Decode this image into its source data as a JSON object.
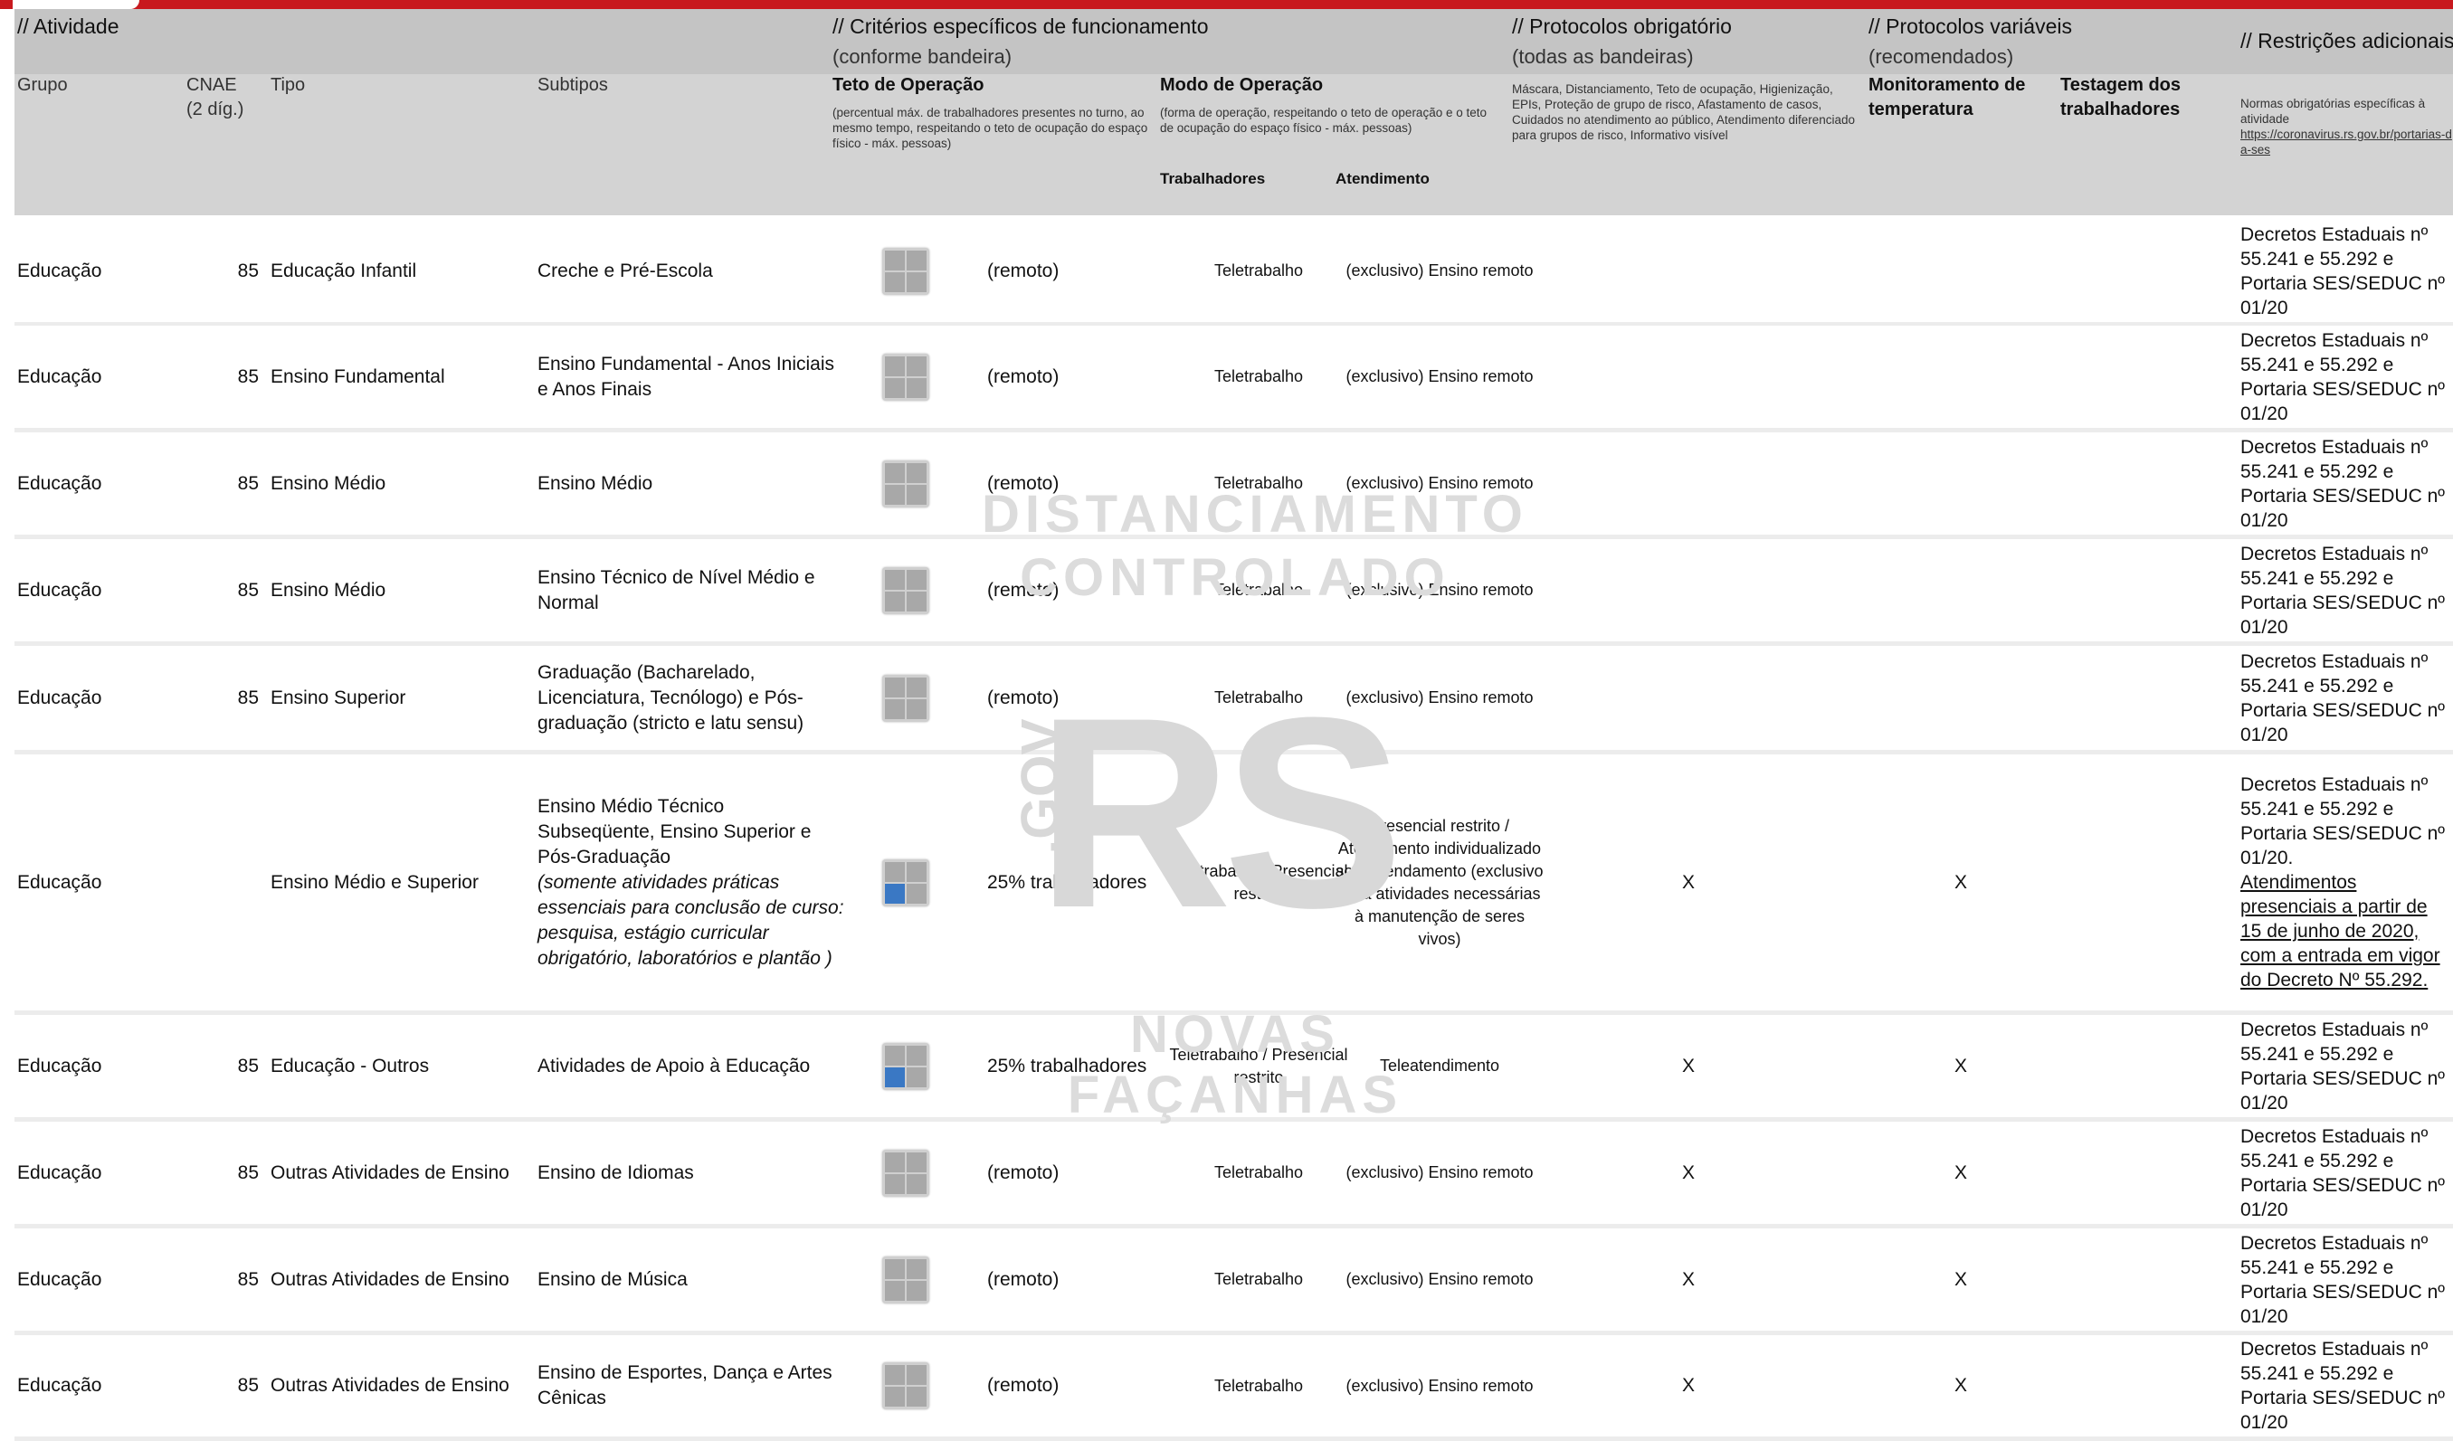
{
  "header": {
    "atividade": "// Atividade",
    "criterios": "// Critérios específicos de funcionamento",
    "criterios_sub": "(conforme bandeira)",
    "prot_obrig": "// Protocolos obrigatório",
    "prot_obrig_sub": "(todas as bandeiras)",
    "prot_var": "// Protocolos variáveis",
    "prot_var_sub": "(recomendados)",
    "restricoes": "// Restrições adicionais",
    "col_grupo": "Grupo",
    "col_cnae_1": "CNAE",
    "col_cnae_2": "(2 díg.)",
    "col_tipo": "Tipo",
    "col_subtipos": "Subtipos",
    "col_teto": "Teto de Operação",
    "col_teto_note": "(percentual máx. de trabalhadores presentes no turno, ao mesmo tempo, respeitando o teto de ocupação do espaço físico - máx. pessoas)",
    "col_modo": "Modo de Operação",
    "col_modo_note": "(forma de operação, respeitando o teto de operação e o teto de ocupação do espaço físico - máx. pessoas)",
    "col_trabalhadores": "Trabalhadores",
    "col_atendimento": "Atendimento",
    "col_obrig_note": "Máscara, Distanciamento, Teto de ocupação, Higienização, EPIs, Proteção de grupo de risco, Afastamento de casos, Cuidados no atendimento ao público, Atendimento diferenciado para grupos de risco, Informativo visível",
    "col_monitoramento": "Monitoramento de temperatura",
    "col_testagem": "Testagem dos trabalhadores",
    "col_restr_note": "Normas obrigatórias específicas à atividade",
    "col_restr_link": "https://coronavirus.rs.gov.br/portarias-da-ses"
  },
  "watermark": {
    "line1": "DISTANCIAMENTO",
    "line2": "CONTROLADO",
    "brand": "RS",
    "gov": ".GOV",
    "slogan": "NOVAS FAÇANHAS"
  },
  "rows": [
    {
      "grupo": "Educação",
      "cnae": "85",
      "tipo": "Educação Infantil",
      "subtipo": "Creche e Pré-Escola",
      "subtipo_ital": "",
      "teto": "(remoto)",
      "trab": "Teletrabalho",
      "atend": "(exclusivo) Ensino remoto",
      "x1": "",
      "x2": "",
      "restr": "Decretos Estaduais nº 55.241 e 55.292 e Portaria SES/SEDUC nº 01/20",
      "restr_u": ""
    },
    {
      "grupo": "Educação",
      "cnae": "85",
      "tipo": "Ensino Fundamental",
      "subtipo": "Ensino Fundamental - Anos Iniciais e Anos Finais",
      "subtipo_ital": "",
      "teto": "(remoto)",
      "trab": "Teletrabalho",
      "atend": "(exclusivo) Ensino remoto",
      "x1": "",
      "x2": "",
      "restr": "Decretos Estaduais nº 55.241 e 55.292 e Portaria SES/SEDUC nº 01/20",
      "restr_u": ""
    },
    {
      "grupo": "Educação",
      "cnae": "85",
      "tipo": "Ensino Médio",
      "subtipo": "Ensino Médio",
      "subtipo_ital": "",
      "teto": "(remoto)",
      "trab": "Teletrabalho",
      "atend": "(exclusivo) Ensino remoto",
      "x1": "",
      "x2": "",
      "restr": "Decretos Estaduais nº 55.241 e 55.292 e Portaria SES/SEDUC nº 01/20",
      "restr_u": ""
    },
    {
      "grupo": "Educação",
      "cnae": "85",
      "tipo": "Ensino Médio",
      "subtipo": "Ensino Técnico de Nível Médio e Normal",
      "subtipo_ital": "",
      "teto": "(remoto)",
      "trab": "Teletrabalho",
      "atend": "(exclusivo) Ensino remoto",
      "x1": "",
      "x2": "",
      "restr": "Decretos Estaduais nº 55.241 e 55.292 e Portaria SES/SEDUC nº 01/20",
      "restr_u": ""
    },
    {
      "grupo": "Educação",
      "cnae": "85",
      "tipo": "Ensino Superior",
      "subtipo": "Graduação (Bacharelado, Licenciatura, Tecnólogo) e Pós-graduação (stricto e latu sensu)",
      "subtipo_ital": "",
      "teto": "(remoto)",
      "trab": "Teletrabalho",
      "atend": "(exclusivo) Ensino remoto",
      "x1": "",
      "x2": "",
      "restr": "Decretos Estaduais nº 55.241 e 55.292 e Portaria SES/SEDUC nº 01/20",
      "restr_u": ""
    },
    {
      "grupo": "Educação",
      "cnae": "",
      "tipo": "Ensino Médio e Superior",
      "subtipo": "Ensino Médio Técnico Subseqüente, Ensino Superior e Pós-Graduação",
      "subtipo_ital": "(somente atividades práticas essenciais para conclusão de curso:  pesquisa, estágio curricular obrigatório, laboratórios e plantão )",
      "teto": "25% trabalhadores",
      "trab": "Teletrabalho / Presencial restrito",
      "atend": "Presencial restrito / Atendimento individualizado sob agendamento (exclusivo para atividades necessárias à manutenção de seres vivos)",
      "x1": "X",
      "x2": "X",
      "restr": "Decretos Estaduais nº 55.241 e 55.292 e Portaria SES/SEDUC nº 01/20.",
      "restr_u": "Atendimentos presenciais a partir de 15 de junho de 2020, com a entrada em vigor do Decreto Nº 55.292."
    },
    {
      "grupo": "Educação",
      "cnae": "85",
      "tipo": "Educação - Outros",
      "subtipo": "Atividades de Apoio à Educação",
      "subtipo_ital": "",
      "teto": "25% trabalhadores",
      "trab": "Teletrabalho / Presencial restrito",
      "atend": "Teleatendimento",
      "x1": "X",
      "x2": "X",
      "restr": "Decretos Estaduais nº 55.241 e 55.292 e Portaria SES/SEDUC nº 01/20",
      "restr_u": ""
    },
    {
      "grupo": "Educação",
      "cnae": "85",
      "tipo": "Outras Atividades de Ensino",
      "subtipo": "Ensino de Idiomas",
      "subtipo_ital": "",
      "teto": "(remoto)",
      "trab": "Teletrabalho",
      "atend": "(exclusivo) Ensino remoto",
      "x1": "X",
      "x2": "X",
      "restr": "Decretos Estaduais nº 55.241 e 55.292 e Portaria SES/SEDUC nº 01/20",
      "restr_u": ""
    },
    {
      "grupo": "Educação",
      "cnae": "85",
      "tipo": "Outras Atividades de Ensino",
      "subtipo": "Ensino de Música",
      "subtipo_ital": "",
      "teto": "(remoto)",
      "trab": "Teletrabalho",
      "atend": "(exclusivo) Ensino remoto",
      "x1": "X",
      "x2": "X",
      "restr": "Decretos Estaduais nº 55.241 e 55.292 e Portaria SES/SEDUC nº 01/20",
      "restr_u": ""
    },
    {
      "grupo": "Educação",
      "cnae": "85",
      "tipo": "Outras Atividades de Ensino",
      "subtipo": "Ensino de Esportes, Dança e Artes Cênicas",
      "subtipo_ital": "",
      "teto": "(remoto)",
      "trab": "Teletrabalho",
      "atend": "(exclusivo) Ensino remoto",
      "x1": "X",
      "x2": "X",
      "restr": "Decretos Estaduais nº 55.241 e 55.292 e Portaria SES/SEDUC nº 01/20",
      "restr_u": ""
    }
  ]
}
